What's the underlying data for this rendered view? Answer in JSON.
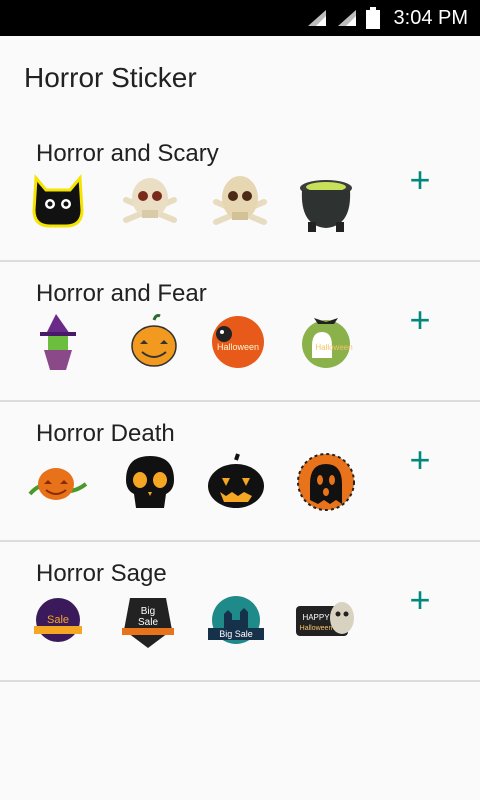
{
  "status_bar": {
    "time": "3:04 PM",
    "icons": [
      "signal-icon",
      "signal-icon",
      "battery-icon"
    ]
  },
  "app_title": "Horror Sticker",
  "packs": [
    {
      "name": "Horror and Scary",
      "add_label": "+",
      "stickers": [
        "black-cat-sticker",
        "skull-crossbones-sticker",
        "skull-crossbones-sticker",
        "cauldron-sticker"
      ]
    },
    {
      "name": "Horror and Fear",
      "add_label": "+",
      "stickers": [
        "witch-sticker",
        "pumpkin-sticker",
        "happy-halloween-sticker",
        "happy-halloween-ghost-sticker"
      ]
    },
    {
      "name": "Horror Death",
      "add_label": "+",
      "stickers": [
        "pumpkin-vine-sticker",
        "black-skull-sticker",
        "jack-o-lantern-sticker",
        "orange-ghost-sticker"
      ]
    },
    {
      "name": "Horror Sage",
      "add_label": "+",
      "stickers": [
        "halloween-sale-badge-sticker",
        "big-sale-sign-sticker",
        "big-sale-castle-sticker",
        "happy-halloween-ghost-badge-sticker"
      ]
    }
  ],
  "sticker_text": {
    "sale": "Sale",
    "big_sale": "Big Sale",
    "big": "Big",
    "happy": "HAPPY",
    "halloween": "Halloween",
    "happy_small": "Happy"
  }
}
